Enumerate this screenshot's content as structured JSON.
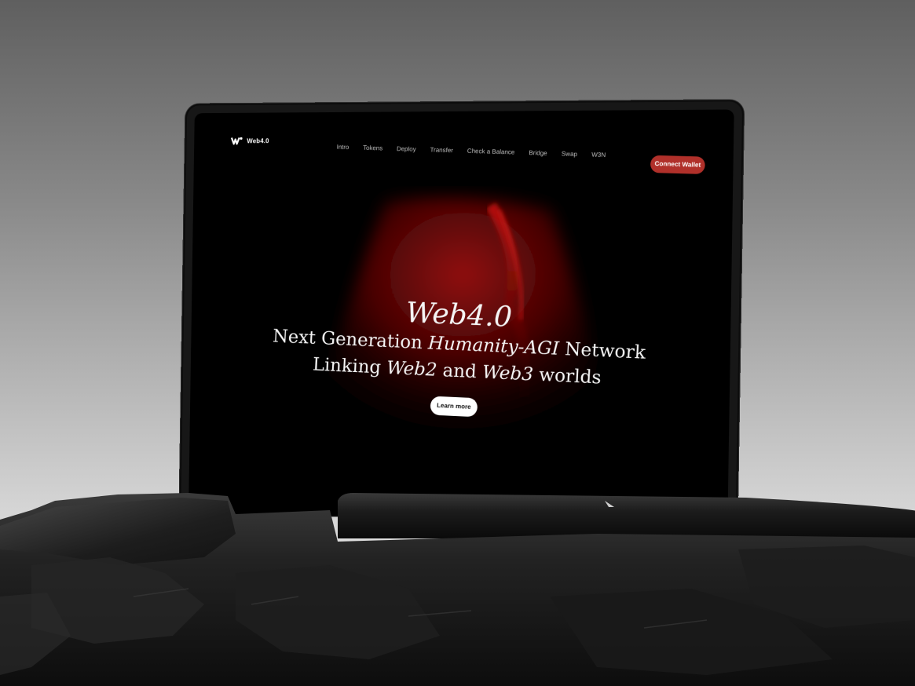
{
  "brand": {
    "logo_icon": "w-logo-icon",
    "name": "Web4.0"
  },
  "nav": {
    "items": [
      {
        "label": "Intro"
      },
      {
        "label": "Tokens"
      },
      {
        "label": "Deploy"
      },
      {
        "label": "Transfer"
      },
      {
        "label": "Check a Balance"
      },
      {
        "label": "Bridge"
      },
      {
        "label": "Swap"
      },
      {
        "label": "W3N"
      }
    ],
    "connect_label": "Connect Wallet"
  },
  "hero": {
    "title": "Web4.0",
    "line1_prefix": "Next Generation ",
    "line1_emph": "Humanity-AGI",
    "line1_suffix": " Network",
    "line2_prefix": "Linking ",
    "line2_emph1": "Web2",
    "line2_mid": " and ",
    "line2_emph2": "Web3",
    "line2_suffix": " worlds",
    "cta_label": "Learn more"
  },
  "colors": {
    "accent": "#b0302a",
    "glow": "#8a0b0b",
    "screen_bg": "#000000"
  }
}
